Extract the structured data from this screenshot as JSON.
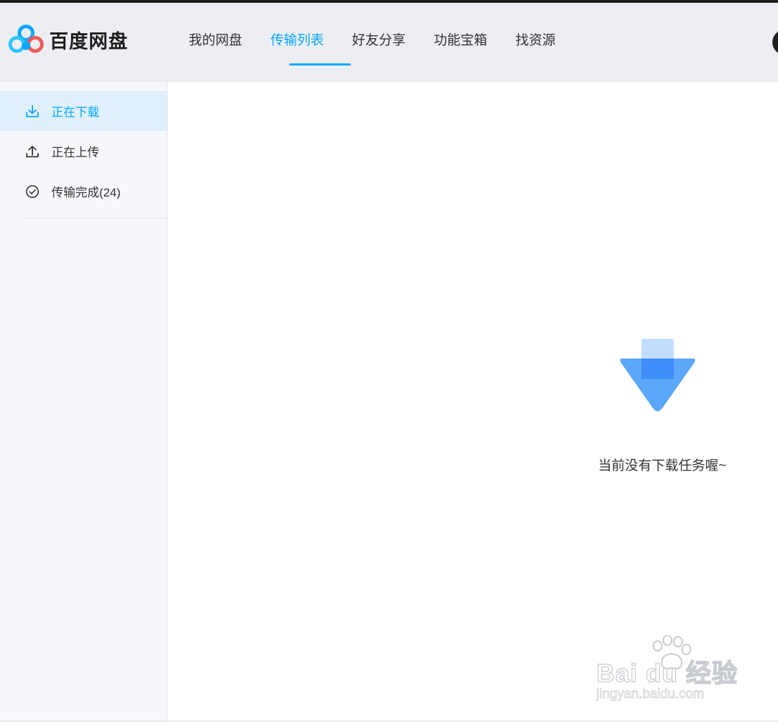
{
  "app": {
    "brand_name": "百度网盘",
    "accent_color": "#06a7ff"
  },
  "nav": {
    "items": [
      {
        "label": "我的网盘",
        "active": false
      },
      {
        "label": "传输列表",
        "active": true
      },
      {
        "label": "好友分享",
        "active": false
      },
      {
        "label": "功能宝箱",
        "active": false
      },
      {
        "label": "找资源",
        "active": false
      }
    ]
  },
  "sidebar": {
    "items": [
      {
        "label": "正在下载",
        "icon": "download-icon",
        "active": true
      },
      {
        "label": "正在上传",
        "icon": "upload-icon",
        "active": false
      },
      {
        "label": "传输完成(24)",
        "icon": "check-circle-icon",
        "active": false
      }
    ]
  },
  "main": {
    "empty_state_text": "当前没有下载任务喔~",
    "empty_state_icon": "download-arrow-illustration"
  },
  "watermark": {
    "brand": "Bai du 经验",
    "url": "jingyan.baidu.com"
  }
}
